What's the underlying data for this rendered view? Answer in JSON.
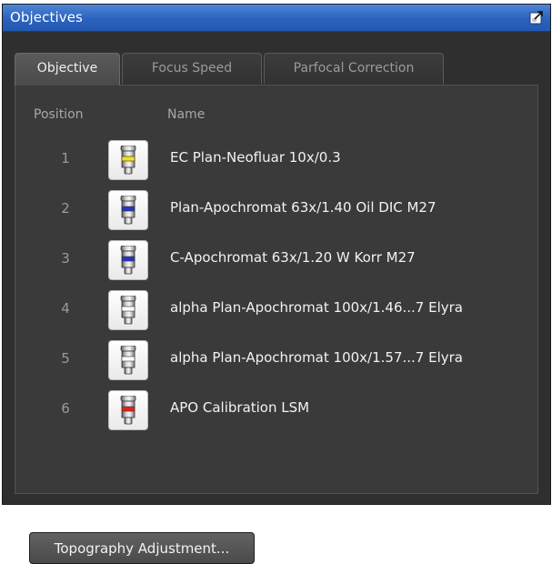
{
  "panel": {
    "title": "Objectives",
    "undock_icon": "undock-icon"
  },
  "tabs": [
    {
      "label": "Objective",
      "active": true
    },
    {
      "label": "Focus Speed",
      "active": false
    },
    {
      "label": "Parfocal Correction",
      "active": false
    }
  ],
  "table": {
    "col_position": "Position",
    "col_name": "Name",
    "rows": [
      {
        "position": "1",
        "name": "EC Plan-Neofluar 10x/0.3",
        "icon": "objective-icon",
        "band_color": "#f2e21a"
      },
      {
        "position": "2",
        "name": "Plan-Apochromat 63x/1.40 Oil DIC M27",
        "icon": "objective-icon",
        "band_color": "#2437b8"
      },
      {
        "position": "3",
        "name": "C-Apochromat 63x/1.20 W Korr M27",
        "icon": "objective-icon",
        "band_color": "#2437b8"
      },
      {
        "position": "4",
        "name": "alpha Plan-Apochromat 100x/1.46...7 Elyra",
        "icon": "objective-icon",
        "band_color": "#ffffff"
      },
      {
        "position": "5",
        "name": "alpha Plan-Apochromat 100x/1.57...7 Elyra",
        "icon": "objective-icon",
        "band_color": "#ffffff"
      },
      {
        "position": "6",
        "name": "APO Calibration LSM",
        "icon": "objective-icon",
        "band_color": "#e0221f"
      }
    ]
  },
  "actions": {
    "topography_label": "Topography Adjustment..."
  }
}
